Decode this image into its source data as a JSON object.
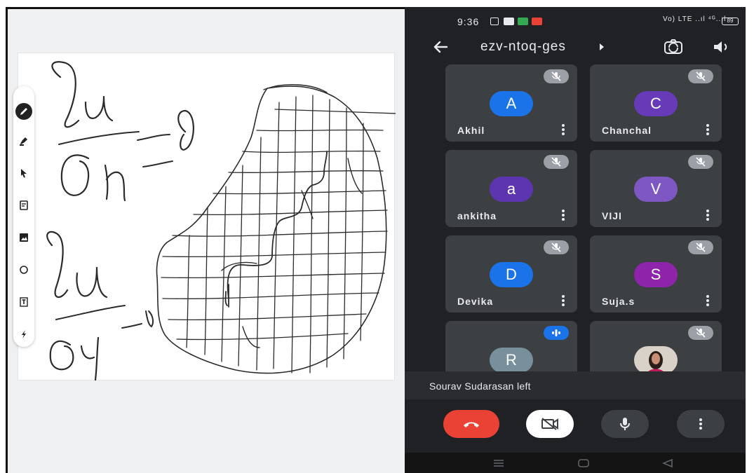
{
  "phone": {
    "status_time": "9:36",
    "status_right": "Vo) LTE ..ıl ⁴ᴳ..ıl",
    "battery": "89",
    "meeting_code": "ezv-ntoq-ges",
    "participants": [
      {
        "name": "Akhil",
        "initial": "A",
        "color": "#1a73e8",
        "mic": "muted"
      },
      {
        "name": "Chanchal",
        "initial": "C",
        "color": "#673ab7",
        "mic": "muted"
      },
      {
        "name": "ankitha",
        "initial": "a",
        "color": "#5e35b1",
        "mic": "muted"
      },
      {
        "name": "VIJI",
        "initial": "V",
        "color": "#7e57c2",
        "mic": "muted"
      },
      {
        "name": "Devika",
        "initial": "D",
        "color": "#1a73e8",
        "mic": "muted"
      },
      {
        "name": "Suja.s",
        "initial": "S",
        "color": "#8e24aa",
        "mic": "muted"
      },
      {
        "name": "",
        "initial": "R",
        "color": "#78909c",
        "mic": "speaking"
      },
      {
        "name": "",
        "initial": "",
        "color": "#ffffff",
        "mic": "muted",
        "photo": true
      }
    ],
    "notification": "Sourav Sudarasan left",
    "accent_end_call": "#ea4335"
  },
  "whiteboard": {
    "tools": [
      "pen-icon",
      "highlighter-icon",
      "pointer-icon",
      "sticky-note-icon",
      "image-icon",
      "shape-circle-icon",
      "text-box-icon",
      "laser-icon"
    ]
  }
}
